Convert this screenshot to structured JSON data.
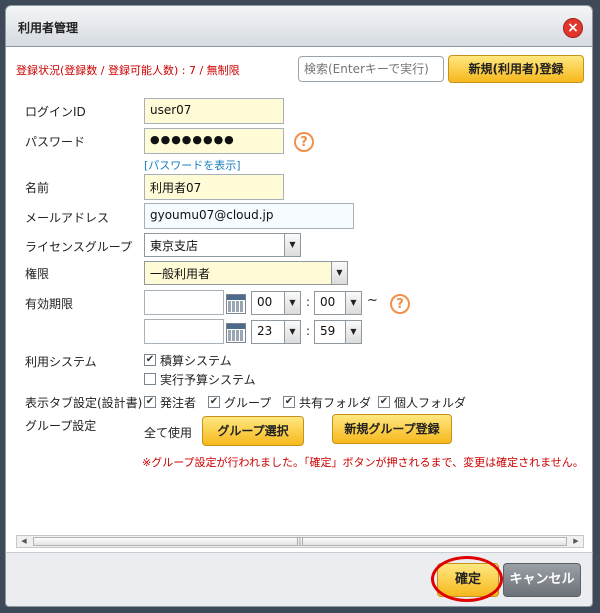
{
  "dialog": {
    "title": "利用者管理",
    "close_icon": "×"
  },
  "header": {
    "status_text": "登録状況(登録数 / 登録可能人数) : 7 / 無制限",
    "search_placeholder": "検索(Enterキーで実行)",
    "new_user_button": "新規(利用者)登録"
  },
  "form": {
    "login_id_label": "ログインID",
    "login_id_value": "user07",
    "password_label": "パスワード",
    "password_value": "●●●●●●●●",
    "help_icon": "?",
    "show_password_link": "[パスワードを表示]",
    "name_label": "名前",
    "name_value": "利用者07",
    "email_label": "メールアドレス",
    "email_value": "gyoumu07@cloud.jp",
    "license_group_label": "ライセンスグループ",
    "license_group_value": "東京支店",
    "permission_label": "権限",
    "permission_value": "一般利用者",
    "validity_label": "有効期限",
    "validity_start_date": "",
    "validity_start_hour": "00",
    "validity_start_minute": "00",
    "validity_end_date": "",
    "validity_end_hour": "23",
    "validity_end_minute": "59",
    "time_colon": ":",
    "tilde": "~",
    "system_label": "利用システム",
    "system_options": [
      {
        "label": "積算システム",
        "checked": true
      },
      {
        "label": "実行予算システム",
        "checked": false
      }
    ],
    "display_tab_label": "表示タブ設定(設計書)",
    "display_tabs": [
      {
        "label": "発注者",
        "checked": true
      },
      {
        "label": "グループ",
        "checked": true
      },
      {
        "label": "共有フォルダ",
        "checked": true
      },
      {
        "label": "個人フォルダ",
        "checked": true
      }
    ],
    "group_setting_label": "グループ設定",
    "group_all_use": "全て使用",
    "group_select_button": "グループ選択",
    "new_group_button": "新規グループ登録",
    "group_notice": "※グループ設定が行われました。「確定」ボタンが押されるまで、変更は確定されません。"
  },
  "scrollbar": {
    "grip": "|||"
  },
  "footer": {
    "confirm_button": "確定",
    "cancel_button": "キャンセル"
  },
  "colors": {
    "accent_yellow": "#f6b81d",
    "notice_red": "#cc0000",
    "link_blue": "#1a7fbf",
    "highlight_ring": "#e00000"
  }
}
